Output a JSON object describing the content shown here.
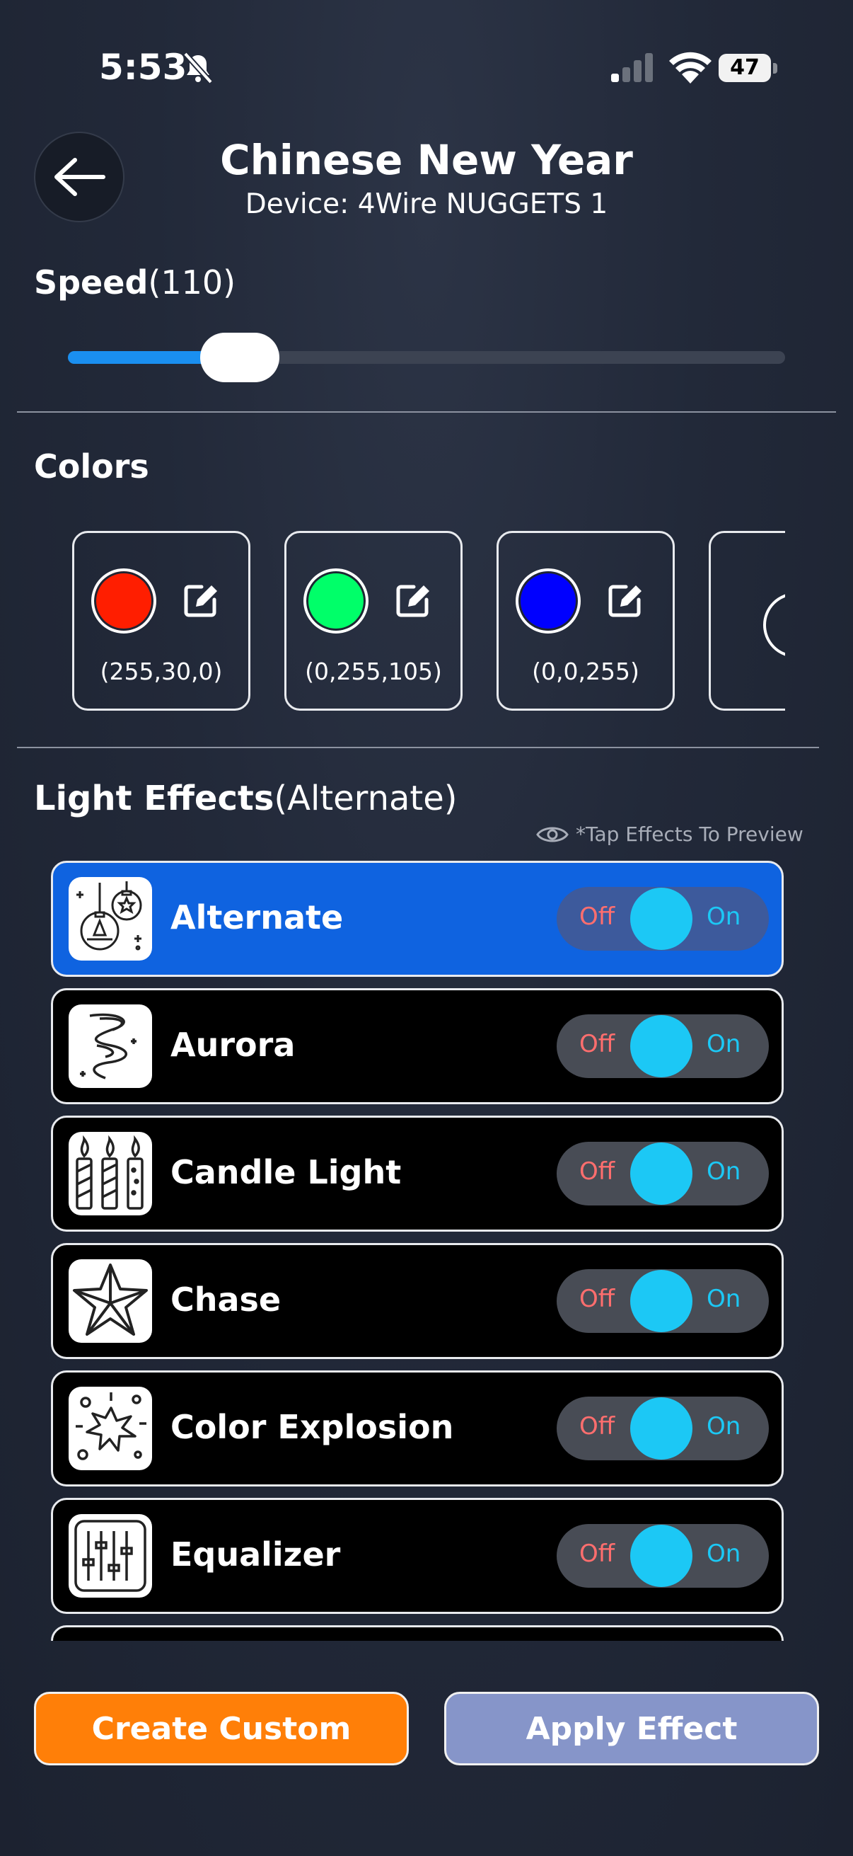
{
  "status_bar": {
    "time": "5:53",
    "battery": "47"
  },
  "header": {
    "title": "Chinese New Year",
    "subtitle": "Device: 4Wire NUGGETS 1"
  },
  "speed": {
    "label": "Speed",
    "value_text": "(110)",
    "slider_fraction": 0.24
  },
  "colors": {
    "heading": "Colors",
    "cards": [
      {
        "hex": "#ff1e00",
        "rgb": "(255,30,0)"
      },
      {
        "hex": "#00ff69",
        "rgb": "(0,255,105)"
      },
      {
        "hex": "#0000ff",
        "rgb": "(0,0,255)"
      }
    ]
  },
  "effects": {
    "heading": "Light Effects",
    "current": "(Alternate)",
    "hint": "*Tap Effects To Preview",
    "off_label": "Off",
    "on_label": "On",
    "items": [
      {
        "name": "Alternate",
        "icon": "ornaments-icon",
        "selected": true
      },
      {
        "name": "Aurora",
        "icon": "aurora-icon",
        "selected": false
      },
      {
        "name": "Candle Light",
        "icon": "candles-icon",
        "selected": false
      },
      {
        "name": "Chase",
        "icon": "star-icon",
        "selected": false
      },
      {
        "name": "Color Explosion",
        "icon": "firework-icon",
        "selected": false
      },
      {
        "name": "Equalizer",
        "icon": "equalizer-icon",
        "selected": false
      }
    ]
  },
  "actions": {
    "create_custom": "Create Custom",
    "apply_effect": "Apply Effect"
  }
}
